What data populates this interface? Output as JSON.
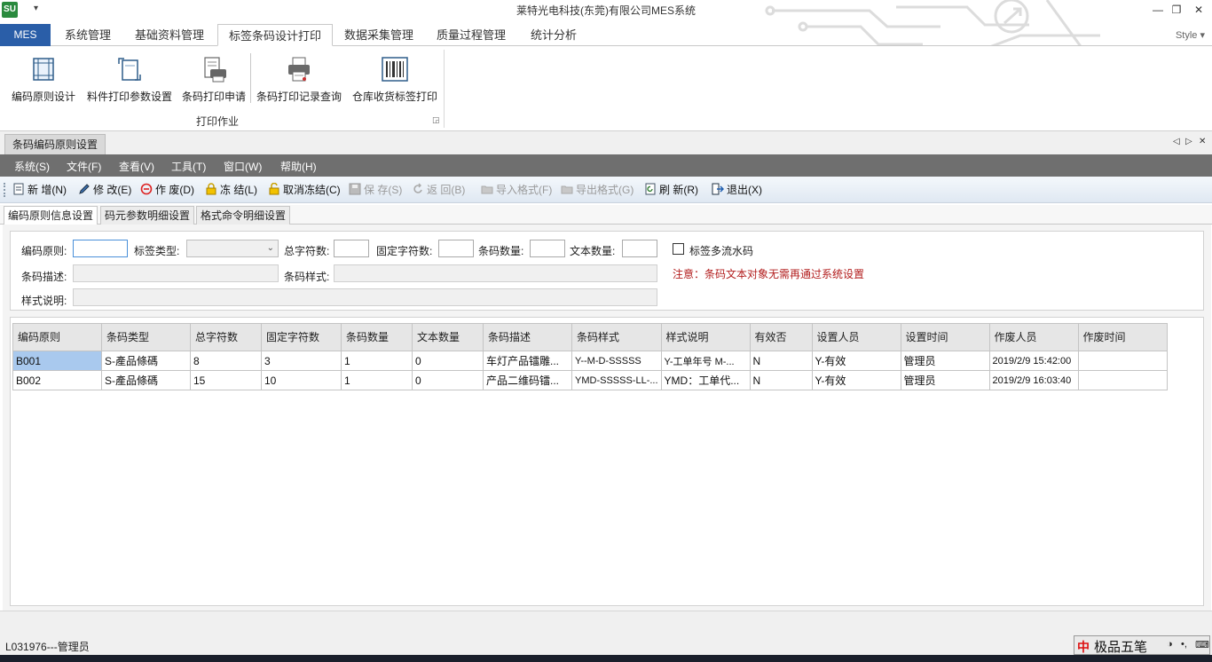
{
  "window": {
    "title": "莱特光电科技(东莞)有限公司MES系统",
    "app_icon": "SU",
    "minimize": "—",
    "restore": "❐",
    "close": "✕"
  },
  "ribbon": {
    "app_button": "MES",
    "tabs": [
      "系统管理",
      "基础资料管理",
      "标签条码设计打印",
      "数据采集管理",
      "质量过程管理",
      "统计分析"
    ],
    "active_tab": 2,
    "style_label": "Style ▾",
    "buttons": [
      {
        "label": "编码原则设计",
        "icon": "frame-icon"
      },
      {
        "label": "料件打印参数设置",
        "icon": "page-setup-icon"
      },
      {
        "label": "条码打印申请",
        "icon": "printer-list-icon"
      },
      {
        "label": "条码打印记录查询",
        "icon": "printer-icon"
      },
      {
        "label": "仓库收货标签打印",
        "icon": "barcode-icon"
      }
    ],
    "group_label": "打印作业"
  },
  "document": {
    "tab_title": "条码编码原则设置",
    "prev": "◁",
    "next": "▷",
    "close": "✕"
  },
  "menu": [
    "系统(S)",
    "文件(F)",
    "查看(V)",
    "工具(T)",
    "窗口(W)",
    "帮助(H)"
  ],
  "toolbar": {
    "new": "新 增(N)",
    "edit": "修 改(E)",
    "void": "作 废(D)",
    "freeze": "冻 结(L)",
    "unfreeze": "取消冻结(C)",
    "save": "保 存(S)",
    "undo": "返 回(B)",
    "import": "导入格式(F)",
    "export": "导出格式(G)",
    "refresh": "刷 新(R)",
    "exit": "退出(X)"
  },
  "subtabs": [
    "编码原则信息设置",
    "码元参数明细设置",
    "格式命令明细设置"
  ],
  "form": {
    "rule_label": "编码原则:",
    "rule_value": "",
    "label_type_label": "标签类型:",
    "label_type_value": "",
    "total_chars_label": "总字符数:",
    "fixed_chars_label": "固定字符数:",
    "barcode_count_label": "条码数量:",
    "text_count_label": "文本数量:",
    "multi_serial_label": "标签多流水码",
    "barcode_desc_label": "条码描述:",
    "barcode_style_label": "条码样式:",
    "style_desc_label": "样式说明:",
    "note": "注意：条码文本对象无需再通过系统设置"
  },
  "grid": {
    "columns": [
      "编码原则",
      "条码类型",
      "总字符数",
      "固定字符数",
      "条码数量",
      "文本数量",
      "条码描述",
      "条码样式",
      "样式说明",
      "有效否",
      "设置人员",
      "设置时间",
      "作废人员",
      "作废时间"
    ],
    "rows": [
      [
        "B001",
        "S-產品條碼",
        "8",
        "3",
        "1",
        "0",
        "车灯产品镭雕...",
        "Y--M-D-SSSSS",
        "Y-工单年号 M-...",
        "N",
        "Y-有效",
        "管理员",
        "2019/2/9 15:42:00",
        ""
      ],
      [
        "B002",
        "S-產品條碼",
        "15",
        "10",
        "1",
        "0",
        "产品二维码镭...",
        "YMD-SSSSS-LL-...",
        "YMD：工单代...",
        "N",
        "Y-有效",
        "管理员",
        "2019/2/9 16:03:40",
        ""
      ]
    ]
  },
  "status": {
    "user": "L031976---管理员"
  },
  "ime": {
    "logo": "中",
    "text": "极品五笔",
    "icons": [
      "◑",
      "•,",
      "⌨"
    ]
  }
}
